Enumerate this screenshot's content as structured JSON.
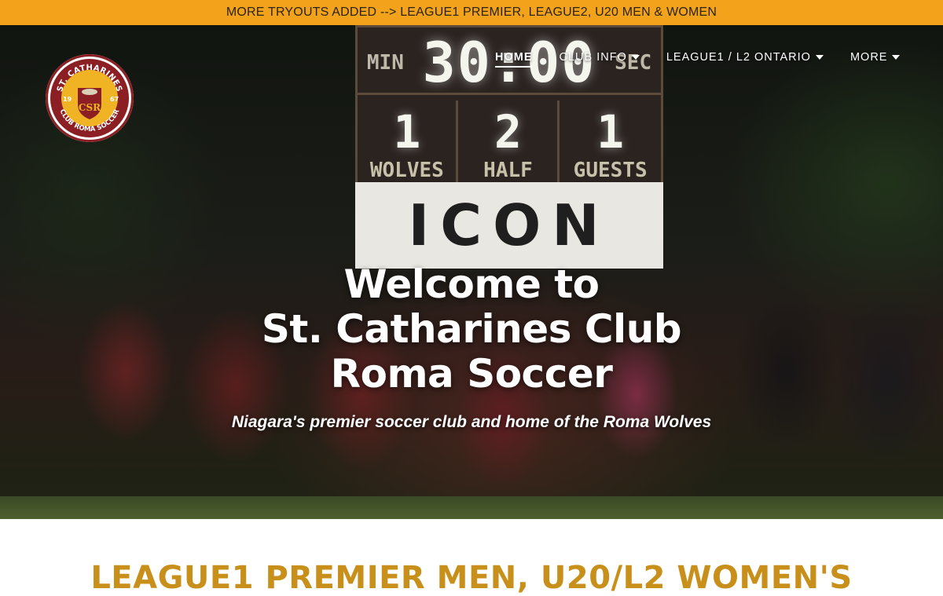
{
  "announcement": {
    "text": "MORE TRYOUTS ADDED --> LEAGUE1 PREMIER, LEAGUE2, U20 MEN & WOMEN"
  },
  "logo": {
    "top_text": "ST. CATHARINES",
    "bottom_text": "CLUB ROMA SOCCER",
    "year_left": "19",
    "year_right": "67",
    "monogram": "CSR"
  },
  "nav": {
    "items": [
      {
        "label": "HOME",
        "active": true,
        "has_dropdown": false
      },
      {
        "label": "CLUB INFO",
        "active": false,
        "has_dropdown": true
      },
      {
        "label": "LEAGUE1 / L2 ONTARIO",
        "active": false,
        "has_dropdown": true
      },
      {
        "label": "MORE",
        "active": false,
        "has_dropdown": true
      }
    ]
  },
  "scoreboard": {
    "min_label": "MIN",
    "time": "30:00",
    "sec_label": "SEC",
    "home_score": "1",
    "half": "2",
    "guest_score": "1",
    "home_label": "WOLVES",
    "half_label": "HALF",
    "guest_label": "GUESTS",
    "sponsor": "ICON"
  },
  "hero": {
    "title_line1": "Welcome to",
    "title_line2": "St. Catharines Club",
    "title_line3": "Roma Soccer",
    "subtitle": "Niagara's premier soccer club and home of the Roma Wolves"
  },
  "section": {
    "heading": "LEAGUE1 PREMIER MEN, U20/L2 WOMEN'S"
  },
  "colors": {
    "announce_bg": "#f2a31b",
    "brand_gold": "#c8901a",
    "brand_maroon": "#8b1f24"
  }
}
